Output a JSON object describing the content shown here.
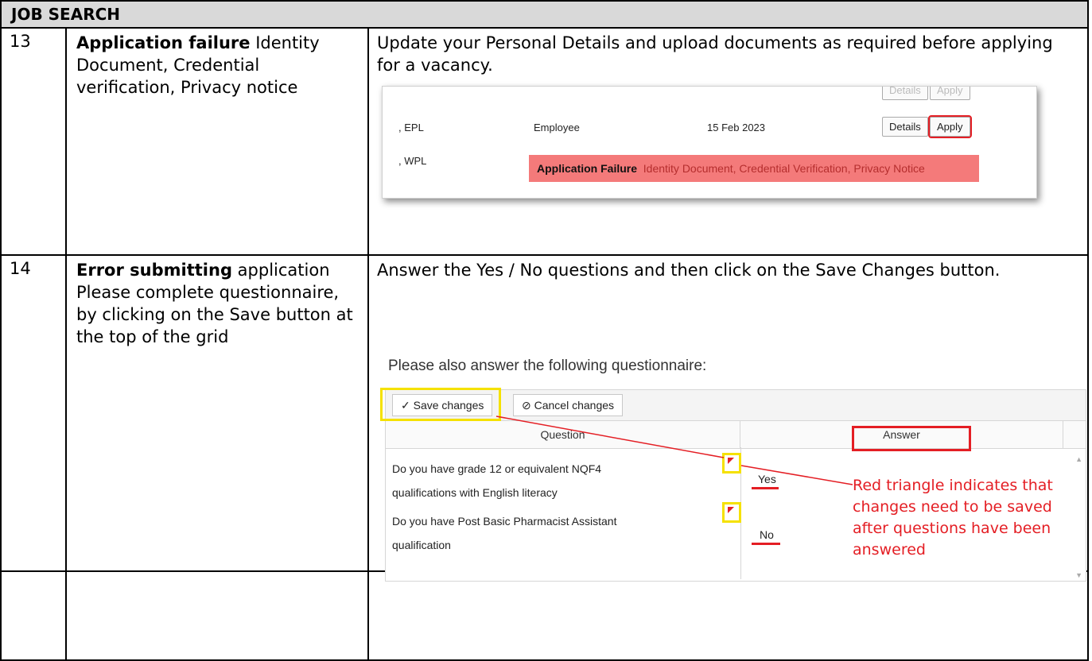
{
  "header": {
    "title": "JOB SEARCH"
  },
  "rows": [
    {
      "number": "13",
      "issue_bold": "Application failure",
      "issue_rest": " Identity Document, Credential verification, Privacy notice",
      "instruction": "Update your Personal Details and upload documents as required before applying for a vacancy."
    },
    {
      "number": "14",
      "issue_bold": "Error submitting",
      "issue_rest": " application Please complete questionnaire, by clicking on the Save button at the top of the grid",
      "instruction": "Answer the Yes / No questions and then click on the Save Changes button."
    }
  ],
  "shot1": {
    "top_row": {
      "name": "",
      "type": "",
      "date": "",
      "details": "Details",
      "apply": "Apply"
    },
    "row_epl": {
      "name": ", EPL",
      "type": "Employee",
      "date": "15 Feb 2023",
      "details": "Details",
      "apply": "Apply"
    },
    "row_wpl": {
      "name": ", WPL"
    },
    "failure_bold": "Application Failure",
    "failure_rest": "Identity Document, Credential Verification, Privacy Notice",
    "bottom_row": {
      "name": "",
      "type": "",
      "date": "",
      "details": "",
      "apply": ""
    }
  },
  "shot2": {
    "title": "Please also answer the following questionnaire:",
    "save_label": "Save changes",
    "cancel_label": "Cancel changes",
    "col_question": "Question",
    "col_answer": "Answer",
    "q1_line1": "Do you have grade 12 or equivalent NQF4",
    "q1_line2": "qualifications with English literacy",
    "a1": "Yes",
    "q2_line1": "Do you have Post Basic Pharmacist Assistant",
    "q2_line2": "qualification",
    "a2": "No",
    "annotation": "Red triangle indicates that changes need to be saved after questions have been answered"
  }
}
